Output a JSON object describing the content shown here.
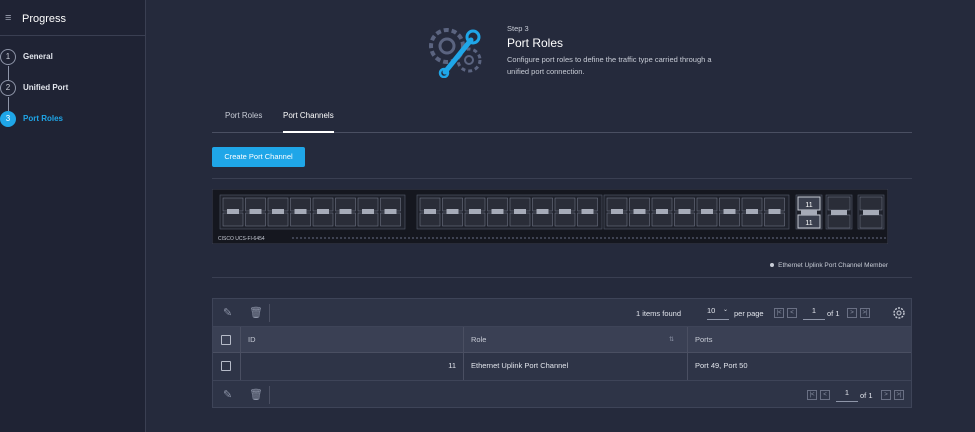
{
  "sidebar": {
    "title": "Progress",
    "steps": [
      {
        "number": "1",
        "label": "General"
      },
      {
        "number": "2",
        "label": "Unified Port"
      },
      {
        "number": "3",
        "label": "Port Roles"
      }
    ]
  },
  "hero": {
    "step": "Step 3",
    "title": "Port Roles",
    "description": "Configure port roles to define the traffic type carried through a unified port connection."
  },
  "tabs": [
    {
      "label": "Port Roles"
    },
    {
      "label": "Port Channels"
    }
  ],
  "actions": {
    "create_label": "Create Port Channel"
  },
  "switch": {
    "model": "CISCO UCS-FI-6454",
    "selected_ports": [
      "11",
      "11"
    ]
  },
  "legend": {
    "label": "Ethernet Uplink Port Channel Member"
  },
  "table": {
    "items_found": "1 items found",
    "per_page_value": "10",
    "per_page_label": "per page",
    "page": "1",
    "of_pages": "of 1",
    "columns": [
      "ID",
      "Role",
      "Ports"
    ],
    "rows": [
      {
        "id": "11",
        "role": "Ethernet Uplink Port Channel",
        "ports": "Port 49, Port 50"
      }
    ]
  },
  "colors": {
    "accent": "#1fa6e8",
    "background": "#252a3c",
    "sidebar": "#1f2334"
  }
}
